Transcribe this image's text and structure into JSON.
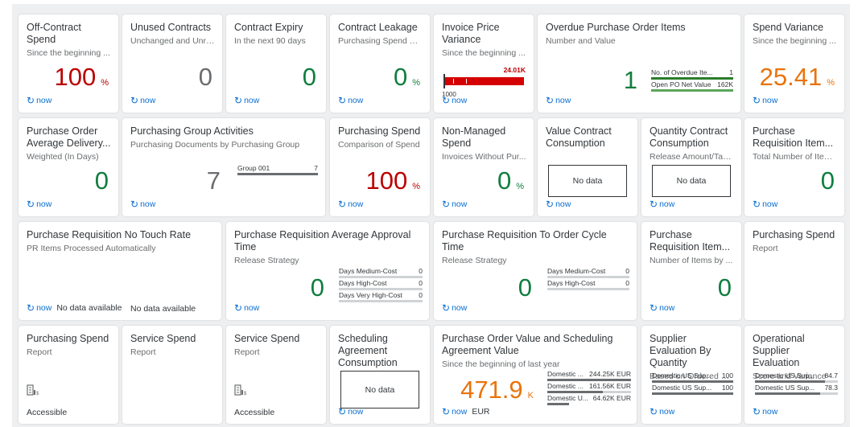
{
  "common": {
    "refresh_label": "now",
    "refresh_icon": "↻"
  },
  "row1": [
    {
      "title": "Off-Contract Spend",
      "sub": "Since the beginning ...",
      "kpi": "100",
      "scale": "%",
      "color": "red"
    },
    {
      "title": "Unused Contracts",
      "sub": "Unchanged and Unre...",
      "kpi": "0",
      "scale": "",
      "color": "grey"
    },
    {
      "title": "Contract Expiry",
      "sub": "In the next 90 days",
      "kpi": "0",
      "scale": "",
      "color": "green"
    },
    {
      "title": "Contract Leakage",
      "sub": "Purchasing Spend wi...",
      "kpi": "0",
      "scale": "%",
      "color": "green"
    },
    {
      "title": "Invoice Price Variance",
      "sub": "Since the beginning ...",
      "bar_value_label": "24.01K",
      "bar_axis_label": "1000"
    },
    {
      "title": "Overdue Purchase Order Items",
      "sub": "Number and Value",
      "kpi": "1",
      "color": "green",
      "list": [
        {
          "label": "No. of Overdue Ite...",
          "value": "1"
        },
        {
          "label": "Open PO Net Value",
          "value": "162K"
        }
      ]
    },
    {
      "title": "Spend Variance",
      "sub": "Since the beginning ...",
      "kpi": "25.41",
      "scale": "%",
      "color": "orange"
    }
  ],
  "row2": [
    {
      "title": "Purchase Order Average Delivery...",
      "sub": "Weighted (In Days)",
      "kpi": "0",
      "color": "green"
    },
    {
      "title": "Purchasing Group Activities",
      "sub": "Purchasing Documents by Purchasing Group",
      "kpi": "7",
      "color": "grey",
      "list": [
        {
          "label": "Group 001",
          "value": "7"
        }
      ]
    },
    {
      "title": "Purchasing Spend",
      "sub": "Comparison of Spend",
      "kpi": "100",
      "scale": "%",
      "color": "red"
    },
    {
      "title": "Non-Managed Spend",
      "sub": "Invoices Without Pur...",
      "kpi": "0",
      "scale": "%",
      "color": "green"
    },
    {
      "title": "Value Contract Consumption",
      "sub": "",
      "nodata": "No data"
    },
    {
      "title": "Quantity Contract Consumption",
      "sub": "Release Amount/Targ...",
      "nodata": "No data"
    },
    {
      "title": "Purchase Requisition Item...",
      "sub": "Total Number of Item...",
      "kpi": "0",
      "color": "green"
    }
  ],
  "row3": [
    {
      "title": "Purchase Requisition No Touch Rate",
      "sub": "PR Items Processed Automatically",
      "footer_extra": "No data available",
      "extra_text": "No data available"
    },
    {
      "title": "Purchase Requisition Average Approval Time",
      "sub": "Release Strategy",
      "kpi": "0",
      "color": "green",
      "list": [
        {
          "label": "Days Medium-Cost",
          "value": "0"
        },
        {
          "label": "Days High-Cost",
          "value": "0"
        },
        {
          "label": "Days Very High-Cost",
          "value": "0"
        }
      ]
    },
    {
      "title": "Purchase Requisition To Order Cycle Time",
      "sub": "Release Strategy",
      "kpi": "0",
      "color": "green",
      "list": [
        {
          "label": "Days Medium-Cost",
          "value": "0"
        },
        {
          "label": "Days High-Cost",
          "value": "0"
        }
      ]
    },
    {
      "title": "Purchase Requisition Item...",
      "sub": "Number of Items by ...",
      "kpi": "0",
      "color": "green"
    },
    {
      "title": "Purchasing Spend",
      "sub": "Report"
    }
  ],
  "row4": [
    {
      "title": "Purchasing Spend",
      "sub": "Report",
      "footer": "Accessible"
    },
    {
      "title": "Service Spend",
      "sub": "Report"
    },
    {
      "title": "Service Spend",
      "sub": "Report",
      "footer": "Accessible"
    },
    {
      "title": "Scheduling Agreement Consumption",
      "sub": "",
      "nodata": "No data"
    },
    {
      "title": "Purchase Order Value and Scheduling Agreement Value",
      "sub": "Since the beginning of last year",
      "kpi": "471.9",
      "scale": "K",
      "color": "orange",
      "footer_extra": "EUR",
      "list": [
        {
          "label": "Domestic ...",
          "value": "244.25K EUR",
          "fill": 1.0
        },
        {
          "label": "Domestic ...",
          "value": "161.56K EUR",
          "fill": 0.66
        },
        {
          "label": "Domestic U...",
          "value": "64.62K EUR",
          "fill": 0.26
        }
      ]
    },
    {
      "title": "Supplier Evaluation By Quantity",
      "sub": "Based on Ordered an...",
      "list": [
        {
          "label": "Domestic US Sup...",
          "value": "100",
          "fill": 1.0
        },
        {
          "label": "Domestic US Sup...",
          "value": "100",
          "fill": 1.0
        }
      ]
    },
    {
      "title": "Operational Supplier Evaluation",
      "sub": "Score and Variance",
      "list": [
        {
          "label": "Domestic US Sup...",
          "value": "84.7",
          "fill": 0.847
        },
        {
          "label": "Domestic US Sup...",
          "value": "78.3",
          "fill": 0.783
        }
      ]
    }
  ]
}
